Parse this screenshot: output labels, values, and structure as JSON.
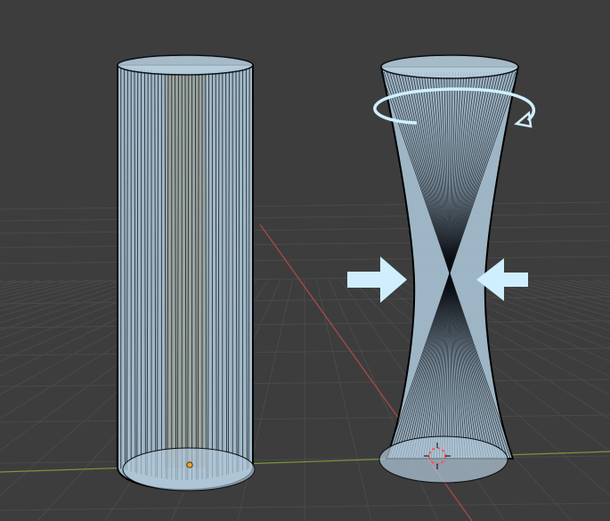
{
  "viewport": {
    "background": "#3d3d3d",
    "grid_color": "#4a4a4a",
    "axis_x_color": "#b04a4a",
    "axis_y_color": "#7a9a3a"
  },
  "objects": [
    {
      "name": "straight-cylinder",
      "kind": "cylinder",
      "selected": true,
      "outline_color": "#000000"
    },
    {
      "name": "twisted-cylinder",
      "kind": "hyperboloid",
      "selected": true,
      "outline_color": "#000000"
    }
  ],
  "cylinder_material": {
    "fill": "#a9c2d4",
    "stroke": "#0b0f14"
  },
  "annotations": {
    "twist_arrow": {
      "icon": "rotate-arrow-icon",
      "color": "#cfefff"
    },
    "pinch_arrows": {
      "icon": "pinch-arrows-icon",
      "color": "#cfefff"
    }
  },
  "origin_point": {
    "icon": "origin-dot-icon",
    "color": "#f2a020"
  },
  "cursor_3d": {
    "icon": "3d-cursor-icon",
    "color": "#ff4b4b"
  }
}
